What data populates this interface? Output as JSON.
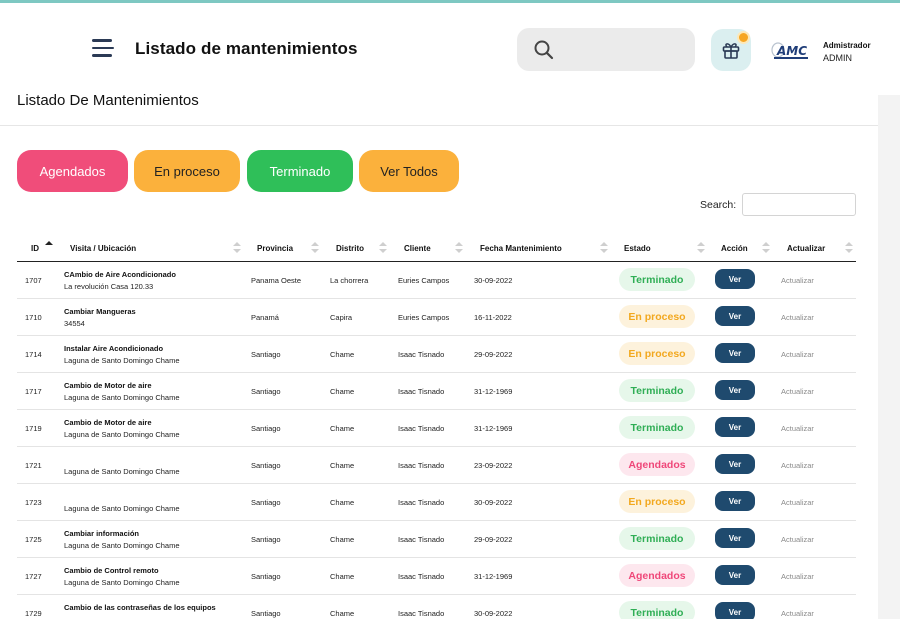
{
  "header": {
    "title": "Listado de mantenimientos",
    "user_role": "Admistrador",
    "user_name": "ADMIN",
    "logo_text": "AMC"
  },
  "page": {
    "heading": "Listado De Mantenimientos"
  },
  "filters": [
    {
      "label": "Agendados"
    },
    {
      "label": "En proceso"
    },
    {
      "label": "Terminado"
    },
    {
      "label": "Ver Todos"
    }
  ],
  "search": {
    "label": "Search:"
  },
  "table": {
    "columns": [
      "ID",
      "Visita / Ubicación",
      "Provincia",
      "Distrito",
      "Cliente",
      "Fecha Mantenimiento",
      "Estado",
      "Acción",
      "Actualizar"
    ],
    "rows": [
      {
        "id": "1707",
        "title": "CAmbio de Aire Acondicionado",
        "sub": "La revolución Casa 120.33",
        "provincia": "Panama Oeste",
        "distrito": "La chorrera",
        "cliente": "Euries Campos",
        "fecha": "30-09-2022",
        "estado": "Terminado",
        "accion": "Ver",
        "actualizar": "Actualizar"
      },
      {
        "id": "1710",
        "title": "Cambiar Mangueras",
        "sub": "34554",
        "provincia": "Panamá",
        "distrito": "Capira",
        "cliente": "Euries Campos",
        "fecha": "16-11-2022",
        "estado": "En proceso",
        "accion": "Ver",
        "actualizar": "Actualizar"
      },
      {
        "id": "1714",
        "title": "Instalar Aire Acondicionado",
        "sub": "Laguna de Santo Domingo Chame",
        "provincia": "Santiago",
        "distrito": "Chame",
        "cliente": "Isaac Tisnado",
        "fecha": "29-09-2022",
        "estado": "En proceso",
        "accion": "Ver",
        "actualizar": "Actualizar"
      },
      {
        "id": "1717",
        "title": "Cambio de Motor de aire",
        "sub": "Laguna de Santo Domingo Chame",
        "provincia": "Santiago",
        "distrito": "Chame",
        "cliente": "Isaac Tisnado",
        "fecha": "31-12-1969",
        "estado": "Terminado",
        "accion": "Ver",
        "actualizar": "Actualizar"
      },
      {
        "id": "1719",
        "title": "Cambio de Motor de aire",
        "sub": "Laguna de Santo Domingo Chame",
        "provincia": "Santiago",
        "distrito": "Chame",
        "cliente": "Isaac Tisnado",
        "fecha": "31-12-1969",
        "estado": "Terminado",
        "accion": "Ver",
        "actualizar": "Actualizar"
      },
      {
        "id": "1721",
        "title": "",
        "sub": "Laguna de Santo Domingo Chame",
        "provincia": "Santiago",
        "distrito": "Chame",
        "cliente": "Isaac Tisnado",
        "fecha": "23-09-2022",
        "estado": "Agendados",
        "accion": "Ver",
        "actualizar": "Actualizar"
      },
      {
        "id": "1723",
        "title": "",
        "sub": "Laguna de Santo Domingo Chame",
        "provincia": "Santiago",
        "distrito": "Chame",
        "cliente": "Isaac Tisnado",
        "fecha": "30-09-2022",
        "estado": "En proceso",
        "accion": "Ver",
        "actualizar": "Actualizar"
      },
      {
        "id": "1725",
        "title": "Cambiar información",
        "sub": "Laguna de Santo Domingo Chame",
        "provincia": "Santiago",
        "distrito": "Chame",
        "cliente": "Isaac Tisnado",
        "fecha": "29-09-2022",
        "estado": "Terminado",
        "accion": "Ver",
        "actualizar": "Actualizar"
      },
      {
        "id": "1727",
        "title": "Cambio de Control remoto",
        "sub": "Laguna de Santo Domingo Chame",
        "provincia": "Santiago",
        "distrito": "Chame",
        "cliente": "Isaac Tisnado",
        "fecha": "31-12-1969",
        "estado": "Agendados",
        "accion": "Ver",
        "actualizar": "Actualizar"
      },
      {
        "id": "1729",
        "title": "Cambio de las contraseñas de los equipos",
        "sub": "",
        "provincia": "Santiago",
        "distrito": "Chame",
        "cliente": "Isaac Tisnado",
        "fecha": "30-09-2022",
        "estado": "Terminado",
        "accion": "Ver",
        "actualizar": "Actualizar"
      }
    ]
  },
  "icons": {
    "menu": "hamburger-menu-icon",
    "search": "search-icon",
    "gift": "gift-icon",
    "sort": "sort-arrows-icon"
  },
  "colors": {
    "agendados": "#f04d7a",
    "en_proceso": "#fbb13c",
    "terminado": "#2fbf59",
    "ver_button": "#1f4a6e"
  }
}
